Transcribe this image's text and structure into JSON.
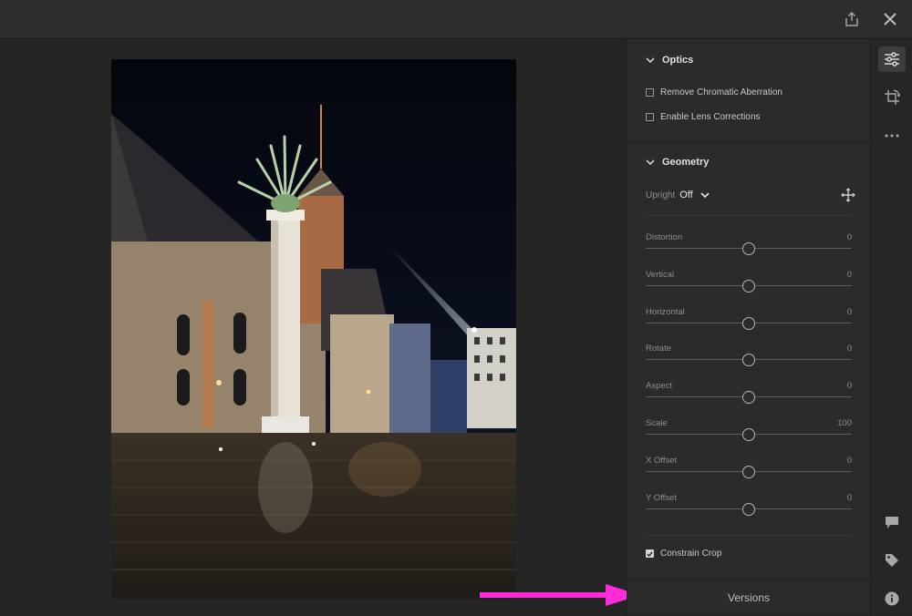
{
  "topbar": {
    "share_icon": "share-icon",
    "close_icon": "close-icon"
  },
  "optics": {
    "title": "Optics",
    "remove_ca": {
      "label": "Remove Chromatic Aberration",
      "checked": false
    },
    "lens_corrections": {
      "label": "Enable Lens Corrections",
      "checked": false
    }
  },
  "geometry": {
    "title": "Geometry",
    "upright_label": "Upright",
    "upright_value": "Off",
    "sliders": [
      {
        "label": "Distortion",
        "value": "0",
        "position": 0.5
      },
      {
        "label": "Vertical",
        "value": "0",
        "position": 0.5
      },
      {
        "label": "Horizontal",
        "value": "0",
        "position": 0.5
      },
      {
        "label": "Rotate",
        "value": "0",
        "position": 0.5
      },
      {
        "label": "Aspect",
        "value": "0",
        "position": 0.5
      },
      {
        "label": "Scale",
        "value": "100",
        "position": 0.5
      },
      {
        "label": "X Offset",
        "value": "0",
        "position": 0.5
      },
      {
        "label": "Y Offset",
        "value": "0",
        "position": 0.5
      }
    ],
    "constrain_crop": {
      "label": "Constrain Crop",
      "checked": true
    }
  },
  "versions_label": "Versions",
  "annotation": {
    "color": "#ff2bd6"
  }
}
